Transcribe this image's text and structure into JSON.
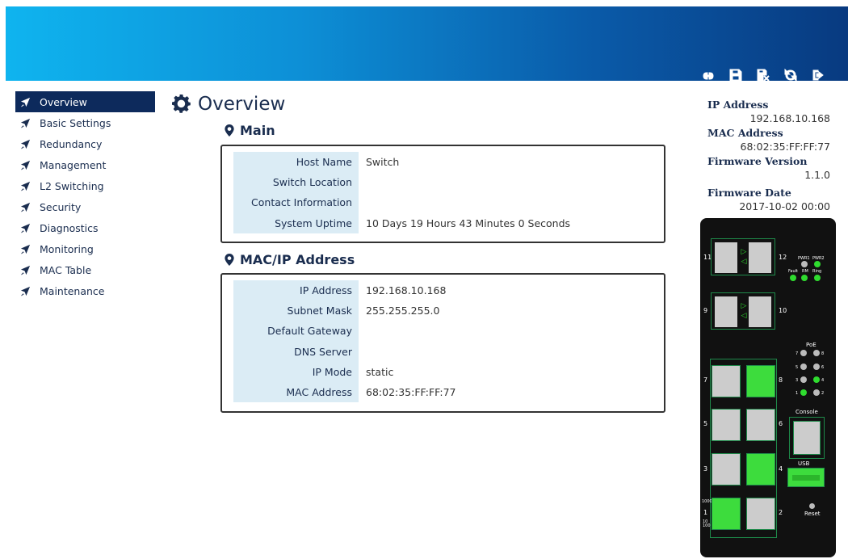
{
  "toolbar": {
    "buttons": [
      {
        "name": "link-icon"
      },
      {
        "name": "save-icon"
      },
      {
        "name": "save-reset-icon"
      },
      {
        "name": "refresh-icon"
      },
      {
        "name": "logout-icon"
      }
    ]
  },
  "sidebar": {
    "items": [
      {
        "label": "Overview",
        "active": true
      },
      {
        "label": "Basic Settings"
      },
      {
        "label": "Redundancy"
      },
      {
        "label": "Management"
      },
      {
        "label": "L2 Switching"
      },
      {
        "label": "Security"
      },
      {
        "label": "Diagnostics"
      },
      {
        "label": "Monitoring"
      },
      {
        "label": "MAC Table"
      },
      {
        "label": "Maintenance"
      }
    ]
  },
  "main": {
    "title": "Overview",
    "sections": {
      "main": {
        "title": "Main",
        "rows": [
          {
            "key": "Host Name",
            "value": "Switch"
          },
          {
            "key": "Switch Location",
            "value": ""
          },
          {
            "key": "Contact Information",
            "value": ""
          },
          {
            "key": "System Uptime",
            "value": "10 Days 19 Hours 43 Minutes 0 Seconds"
          }
        ]
      },
      "macip": {
        "title": "MAC/IP Address",
        "rows": [
          {
            "key": "IP Address",
            "value": "192.168.10.168"
          },
          {
            "key": "Subnet Mask",
            "value": "255.255.255.0"
          },
          {
            "key": "Default Gateway",
            "value": ""
          },
          {
            "key": "DNS Server",
            "value": ""
          },
          {
            "key": "IP Mode",
            "value": "static"
          },
          {
            "key": "MAC Address",
            "value": "68:02:35:FF:FF:77"
          }
        ]
      }
    }
  },
  "info": {
    "ip_label": "IP Address",
    "ip_value": "192.168.10.168",
    "mac_label": "MAC Address",
    "mac_value": "68:02:35:FF:FF:77",
    "fw_label": "Firmware Version",
    "fw_value": "1.1.0",
    "fwdate_label": "Firmware Date",
    "fwdate_value": "2017-10-02 00:00"
  },
  "device": {
    "sfp_ports": [
      "11",
      "12",
      "9",
      "10"
    ],
    "led_labels": {
      "pwr1": "PWR1",
      "pwr2": "PWR2",
      "fault": "Fault",
      "rm": "RM",
      "ring": "Ring",
      "poe": "PoE"
    },
    "poe_numbers": [
      "7",
      "8",
      "5",
      "6",
      "3",
      "4",
      "1",
      "2"
    ],
    "rj_ports": [
      "7",
      "8",
      "5",
      "6",
      "3",
      "4",
      "1",
      "2"
    ],
    "speed_labels": {
      "s1000": "1000",
      "s10100": "10\n100"
    },
    "console_label": "Console",
    "usb_label": "USB",
    "reset_label": "Reset"
  }
}
